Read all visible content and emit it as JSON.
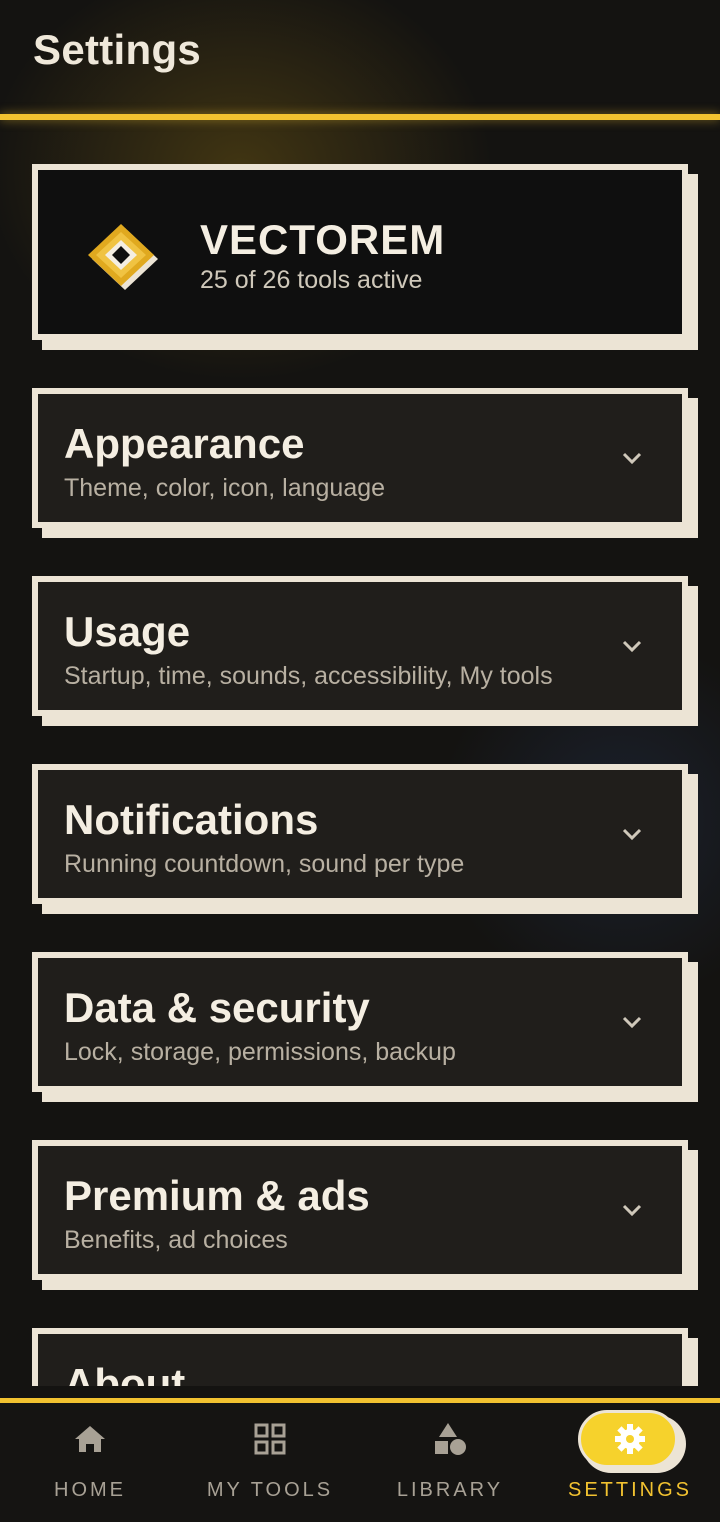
{
  "header": {
    "title": "Settings"
  },
  "brand": {
    "name": "VECTOREM",
    "subtitle": "25 of 26 tools active"
  },
  "sections": [
    {
      "title": "Appearance",
      "subtitle": "Theme, color, icon, language"
    },
    {
      "title": "Usage",
      "subtitle": "Startup, time, sounds, accessibility, My tools"
    },
    {
      "title": "Notifications",
      "subtitle": "Running countdown, sound per type"
    },
    {
      "title": "Data & security",
      "subtitle": "Lock, storage, permissions, backup"
    },
    {
      "title": "Premium & ads",
      "subtitle": "Benefits, ad choices"
    },
    {
      "title": "About",
      "subtitle": ""
    }
  ],
  "nav": {
    "items": [
      {
        "label": "HOME",
        "icon": "home-icon"
      },
      {
        "label": "MY TOOLS",
        "icon": "grid-icon"
      },
      {
        "label": "LIBRARY",
        "icon": "shapes-icon"
      },
      {
        "label": "SETTINGS",
        "icon": "gear-icon",
        "active": true
      }
    ]
  },
  "colors": {
    "accent": "#f2c230",
    "card_border": "#ece4d5",
    "background": "#141311"
  }
}
